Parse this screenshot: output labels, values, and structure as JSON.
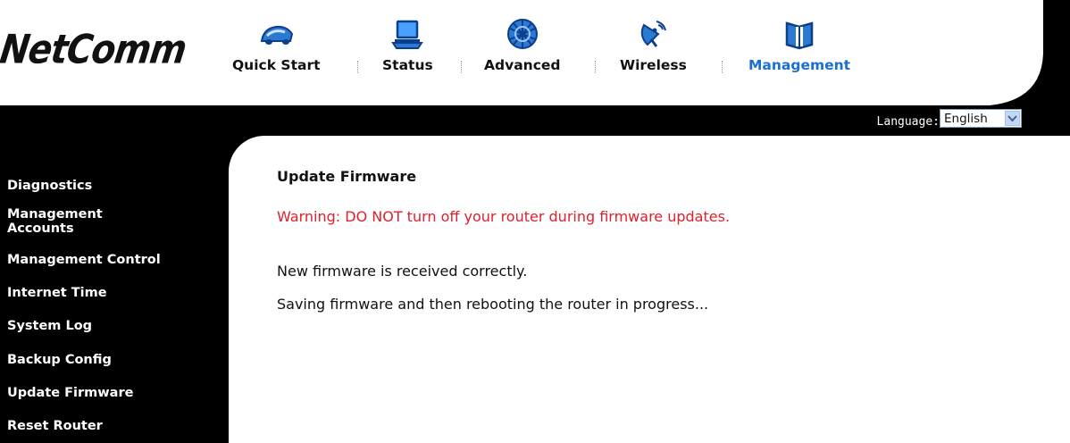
{
  "brand": {
    "logo_text": "NetComm"
  },
  "nav": {
    "items": [
      {
        "label": "Quick Start",
        "icon": "car-icon",
        "active": false
      },
      {
        "label": "Status",
        "icon": "laptop-icon",
        "active": false
      },
      {
        "label": "Advanced",
        "icon": "globe-icon",
        "active": false
      },
      {
        "label": "Wireless",
        "icon": "satellite-icon",
        "active": false
      },
      {
        "label": "Management",
        "icon": "book-icon",
        "active": true
      }
    ],
    "active_color": "#1a6fd0"
  },
  "language": {
    "label": "Language:",
    "selected": "English"
  },
  "sidebar": {
    "items": [
      {
        "label": "Diagnostics"
      },
      {
        "label_line1": "Management",
        "label_line2": "Accounts"
      },
      {
        "label": "Management Control"
      },
      {
        "label": "Internet Time"
      },
      {
        "label": "System Log"
      },
      {
        "label": "Backup Config"
      },
      {
        "label": "Update Firmware"
      },
      {
        "label": "Reset Router"
      }
    ]
  },
  "main": {
    "title": "Update Firmware",
    "warning": "Warning: DO NOT turn off your router during firmware updates.",
    "warning_color": "#e0202c",
    "messages": [
      "New firmware is received correctly.",
      "Saving firmware and then rebooting the router in progress..."
    ]
  }
}
